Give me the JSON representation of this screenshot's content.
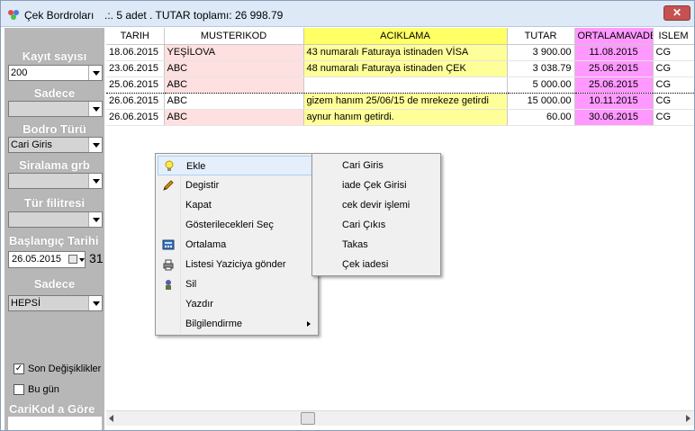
{
  "window": {
    "title": "Çek Bordroları",
    "info": ".:.  5 adet . TUTAR toplamı: 26 998.79",
    "close_label": "✕"
  },
  "sidebar": {
    "kayit_label": "Kayıt sayısı",
    "kayit_value": "200",
    "sadece1_label": "Sadece",
    "sadece1_value": "",
    "bodro_label": "Bodro Türü",
    "bodro_value": "Cari Giris",
    "siralama_label": "Siralama grb",
    "siralama_value": "",
    "tur_label": "Tür filitresi",
    "tur_value": "",
    "baslangic_label": "Başlangıç Tarihi",
    "baslangic_value": "26.05.2015",
    "calendar_day": "31",
    "sadece2_label": "Sadece",
    "sadece2_value": "HEPSİ",
    "son_label": "Son Değişiklikler",
    "son_checked": "✓",
    "bugun_label": "Bu gün",
    "bugun_checked": "",
    "carikod_label": "CariKod a Göre"
  },
  "grid": {
    "headers": [
      "TARIH",
      "MUSTERIKOD",
      "ACIKLAMA",
      "TUTAR",
      "ORTALAMAVADE",
      "ISLEM"
    ],
    "rows": [
      [
        "18.06.2015",
        "YEŞİLOVA",
        "43 numaralı Faturaya istinaden VİSA",
        "3 900.00",
        "11.08.2015",
        "CG"
      ],
      [
        "23.06.2015",
        "ABC",
        "48 numaralı Faturaya istinaden ÇEK",
        "3 038.79",
        "25.06.2015",
        "CG"
      ],
      [
        "25.06.2015",
        "ABC",
        "",
        "5 000.00",
        "25.06.2015",
        "CG"
      ],
      [
        "26.06.2015",
        "ABC",
        "gizem hanım 25/06/15 de mrekeze getirdi",
        "15 000.00",
        "10.11.2015",
        "CG"
      ],
      [
        "26.06.2015",
        "ABC",
        "aynur hanım getirdi.",
        "60.00",
        "30.06.2015",
        "CG"
      ]
    ]
  },
  "context_menu": {
    "items": [
      "Ekle",
      "Degistir",
      "Kapat",
      "Gösterilecekleri Seç",
      "Ortalama",
      "Listesi Yaziciya gönder",
      "Sil",
      "Yazdır",
      "Bilgilendirme"
    ]
  },
  "submenu": {
    "items": [
      "Cari Giris",
      "iade Çek Girisi",
      "cek devir işlemi",
      "Cari Çıkıs",
      "Takas",
      "Çek iadesi"
    ]
  },
  "colors": {
    "sidebar": "#b7b7b7",
    "yellow": "#ffff99",
    "pink": "#ff99ff",
    "rose": "#ffe0e0"
  }
}
